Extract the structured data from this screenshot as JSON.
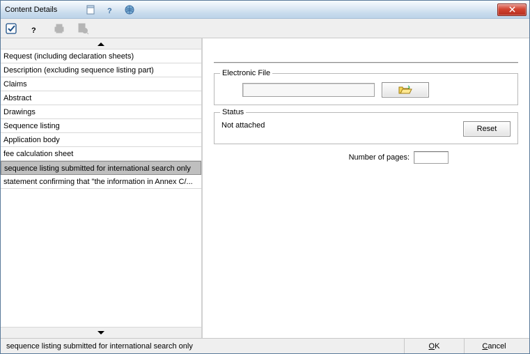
{
  "window": {
    "title": "Content Details"
  },
  "list": {
    "items": [
      "Request (including declaration sheets)",
      "Description (excluding sequence listing part)",
      "Claims",
      "Abstract",
      "Drawings",
      "Sequence listing",
      "Application body",
      "fee calculation sheet",
      "sequence listing submitted for international search only",
      "statement confirming that \"the information in Annex C/..."
    ],
    "selectedIndex": 8
  },
  "form": {
    "electronicFile": {
      "legend": "Electronic File",
      "path": ""
    },
    "status": {
      "legend": "Status",
      "value": "Not attached",
      "resetLabel": "Reset"
    },
    "pages": {
      "label": "Number of pages:",
      "value": ""
    }
  },
  "statusbar": {
    "text": "sequence listing submitted for international search only",
    "ok": "OK",
    "okAccel": "O",
    "cancel": "Cancel",
    "cancelAccel": "C"
  }
}
